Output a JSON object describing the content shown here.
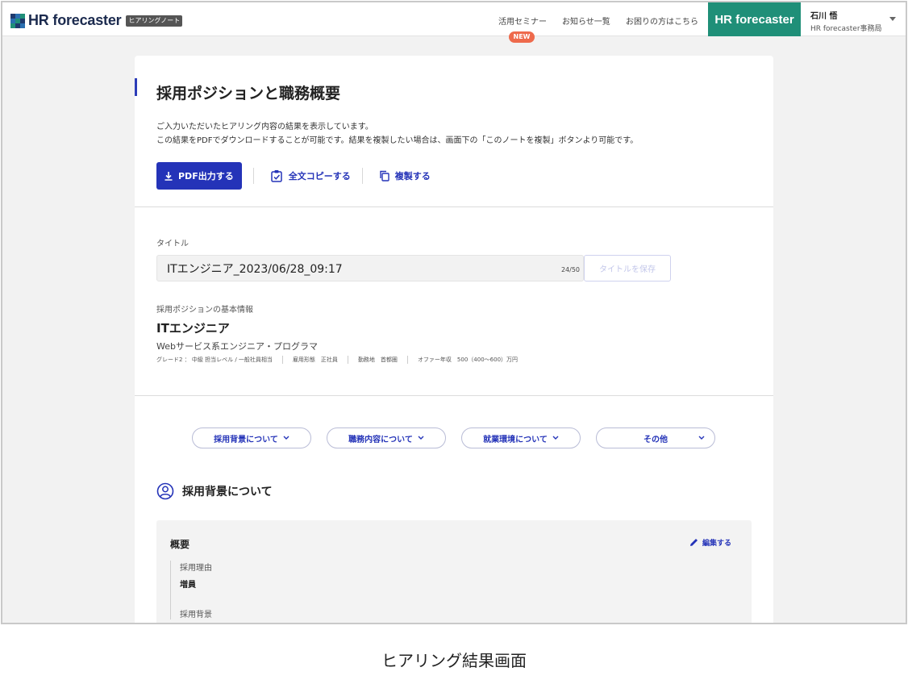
{
  "header": {
    "logo_text": "HR forecaster",
    "logo_badge": "ヒアリングノート",
    "nav": [
      "活用セミナー",
      "お知らせ一覧",
      "お困りの方はこちら"
    ],
    "new_badge": "NEW",
    "brand_button": "HR forecaster",
    "user_name": "石川 悟",
    "user_org": "HR forecaster事務局"
  },
  "page": {
    "title": "採用ポジションと職務概要",
    "desc_line1": "ご入力いただいたヒアリング内容の結果を表示しています。",
    "desc_line2": "この結果をPDFでダウンロードすることが可能です。結果を複製したい場合は、画面下の「このノートを複製」ボタンより可能です。",
    "pdf_button": "PDF出力する",
    "copy_all_button": "全文コピーする",
    "duplicate_button": "複製する"
  },
  "title_field": {
    "label": "タイトル",
    "value": "ITエンジニア_2023/06/28_09:17",
    "counter": "24/50",
    "save_button": "タイトルを保存"
  },
  "position": {
    "label": "採用ポジションの基本情報",
    "title": "ITエンジニア",
    "subtitle": "Webサービス系エンジニア・プログラマ",
    "meta": [
      "グレード2 ： 中級 担当レベル / 一般社員相当",
      "雇用形態　正社員",
      "勤務地　首都圏",
      "オファー年収　500（400〜600）万円"
    ]
  },
  "section_tabs": [
    "採用背景について",
    "職務内容について",
    "就業環境について",
    "その他"
  ],
  "section": {
    "title": "採用背景について",
    "panel_title": "概要",
    "edit_link": "編集する",
    "reason_label": "採用理由",
    "reason_value": "増員",
    "background_label": "採用背景"
  },
  "caption": "ヒアリング結果画面",
  "colors": {
    "accent": "#2433b8",
    "brand_green": "#1f8f78",
    "new_badge": "#ee6a4c"
  }
}
